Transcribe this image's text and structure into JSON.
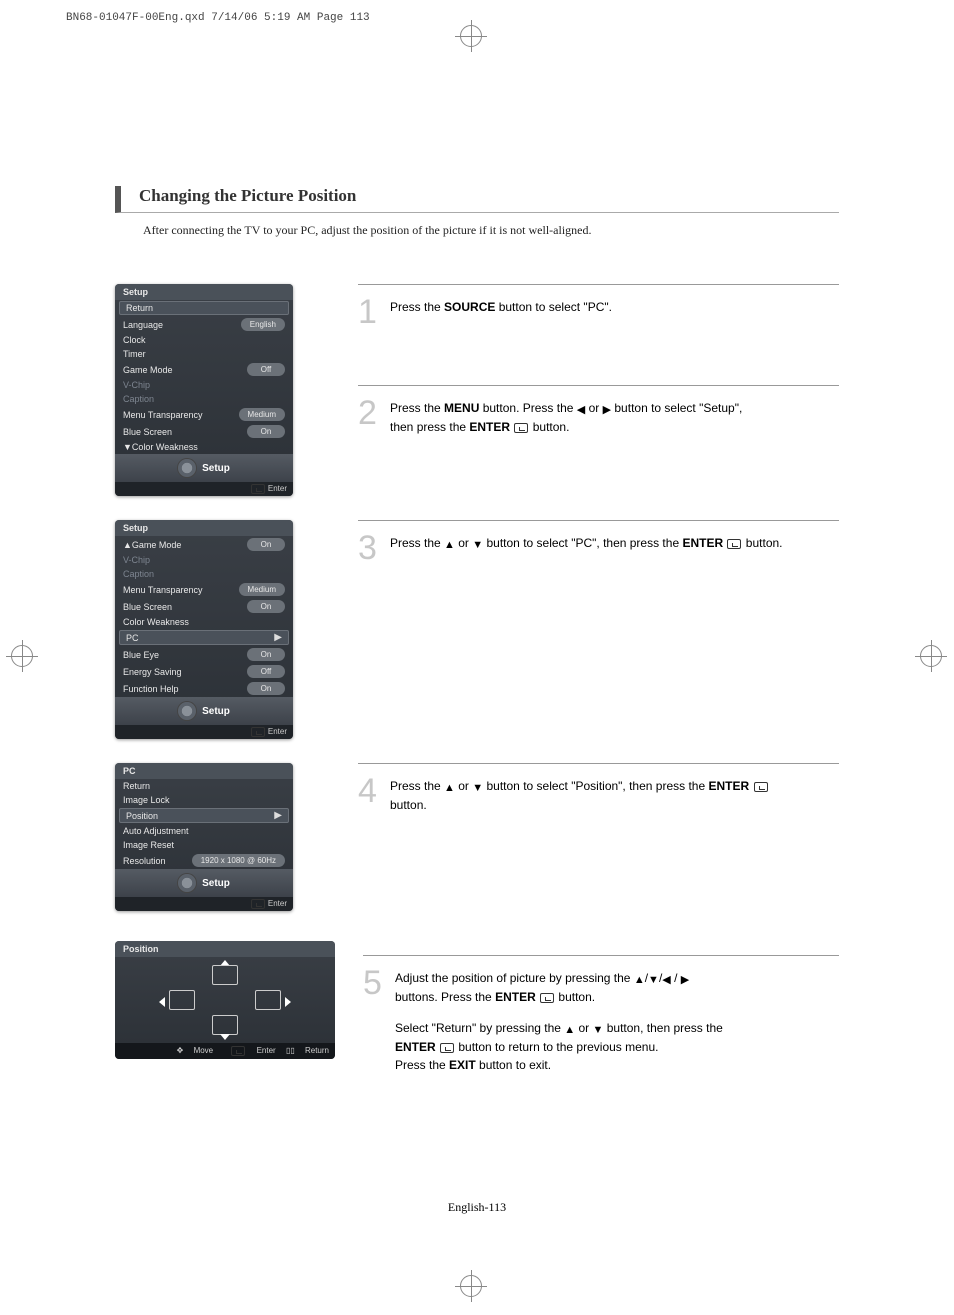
{
  "header": "BN68-01047F-00Eng.qxd  7/14/06  5:19 AM  Page 113",
  "title": "Changing the Picture Position",
  "subtitle": "After connecting the TV to your PC, adjust the position of the picture if it is not well-aligned.",
  "page_number": "English-113",
  "osd_common": {
    "setup_label": "Setup",
    "enter_label": "Enter",
    "move_label": "Move",
    "return_label": "Return"
  },
  "osd1": {
    "title": "Setup",
    "items": [
      {
        "label": "Return",
        "value": "",
        "style": "hl"
      },
      {
        "label": "Language",
        "value": "English"
      },
      {
        "label": "Clock",
        "value": ""
      },
      {
        "label": "Timer",
        "value": ""
      },
      {
        "label": "Game Mode",
        "value": "Off"
      },
      {
        "label": "V-Chip",
        "value": "",
        "dim": true
      },
      {
        "label": "Caption",
        "value": "",
        "dim": true
      },
      {
        "label": "Menu Transparency",
        "value": "Medium"
      },
      {
        "label": "Blue Screen",
        "value": "On"
      },
      {
        "label": "▼Color Weakness",
        "value": ""
      }
    ]
  },
  "osd2": {
    "title": "Setup",
    "items": [
      {
        "label": "▲Game Mode",
        "value": "On"
      },
      {
        "label": "V-Chip",
        "value": "",
        "dim": true
      },
      {
        "label": "Caption",
        "value": "",
        "dim": true
      },
      {
        "label": "Menu Transparency",
        "value": "Medium"
      },
      {
        "label": "Blue Screen",
        "value": "On"
      },
      {
        "label": "Color Weakness",
        "value": ""
      },
      {
        "label": "PC",
        "value": "",
        "style": "hl",
        "chevron": true
      },
      {
        "label": "Blue Eye",
        "value": "On"
      },
      {
        "label": "Energy Saving",
        "value": "Off"
      },
      {
        "label": "Function Help",
        "value": "On"
      }
    ]
  },
  "osd3": {
    "title": "PC",
    "items": [
      {
        "label": "Return",
        "value": "",
        "icon": "return"
      },
      {
        "label": "Image Lock",
        "value": ""
      },
      {
        "label": "Position",
        "value": "",
        "style": "hl",
        "chevron": true
      },
      {
        "label": "Auto Adjustment",
        "value": ""
      },
      {
        "label": "Image Reset",
        "value": ""
      },
      {
        "label": "Resolution",
        "value": "1920 x 1080 @ 60Hz"
      }
    ]
  },
  "osd4": {
    "title": "Position"
  },
  "steps": {
    "s1": {
      "num": "1",
      "pre": "Press the ",
      "b1": "SOURCE",
      "post": " button to select \"PC\"."
    },
    "s2": {
      "num": "2",
      "l1a": "Press the ",
      "l1b": "MENU",
      "l1c": " button. Press the ",
      "l1d": " or ",
      "l1e": " button to select \"Setup\",",
      "l2a": "then press  the ",
      "l2b": "ENTER",
      "l2c": " button."
    },
    "s3": {
      "num": "3",
      "a": "Press the ",
      "b": " or ",
      "c": " button to select \"PC\", then press the ",
      "d": "ENTER",
      "e": " button."
    },
    "s4": {
      "num": "4",
      "a": "Press the ",
      "b": " or ",
      "c": " button to select \"Position\", then press the ",
      "d": "ENTER",
      "e": "button."
    },
    "s5": {
      "num": "5",
      "l1a": "Adjust the position of picture by  pressing the ",
      "l1b": "buttons. Press the ",
      "l1c": "ENTER",
      "l1d": " button.",
      "l2a": "Select \"Return\" by pressing the ",
      "l2b": " or ",
      "l2c": " button, then press the",
      "l3a": "ENTER",
      "l3b": " button to return to the previous menu.",
      "l4a": "Press the ",
      "l4b": "EXIT",
      "l4c": " button to exit."
    }
  }
}
